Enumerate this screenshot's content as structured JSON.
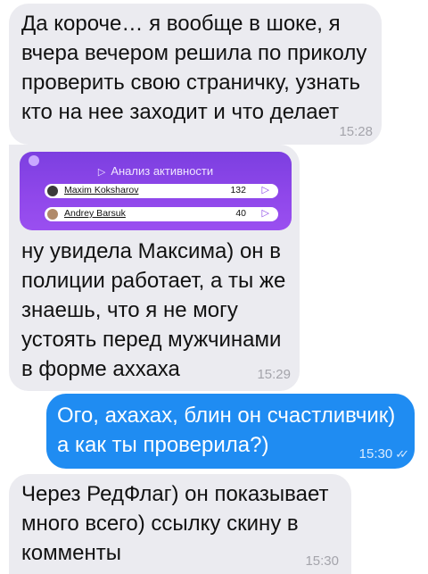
{
  "messages": [
    {
      "text": "Да короче… я вообще в шоке, я\nвчера вечером решила по приколу\nпроверить свою страничку, узнать\nкто на нее заходит и что делает",
      "time": "15:28"
    },
    {
      "text": "ну увидела Максима) он в\nполиции работает, а ты же\nзнаешь, что я не могу\nустоять перед мужчинами\nв форме аххаха",
      "time": "15:29"
    },
    {
      "text": "Ого, ахахах, блин он счастливчик)\nа как ты проверила?)",
      "time": "15:30"
    },
    {
      "text": "Через РедФлаг) он показывает\nмного всего)  ссылку скину в\nкомменты",
      "time": "15:30"
    }
  ],
  "card": {
    "title": "Анализ активности",
    "rows": [
      {
        "name": "Maxim Koksharov",
        "count": "132"
      },
      {
        "name": "Andrey Barsuk",
        "count": "40"
      }
    ]
  },
  "icons": {
    "send": "send-icon",
    "read_receipt": "double-check-icon"
  },
  "colors": {
    "incoming_bubble": "#ebebf0",
    "outgoing_bubble": "#1f8cf2",
    "card_purple": "#8f47ea"
  }
}
